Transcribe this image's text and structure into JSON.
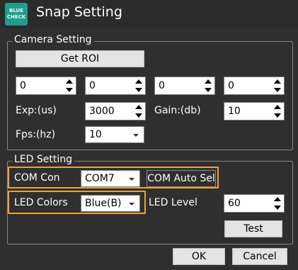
{
  "window": {
    "title": "Snap Setting",
    "logo_text_line1": "BLUE",
    "logo_text_line2": "CHECK"
  },
  "camera": {
    "group_title": "Camera Setting",
    "get_roi_label": "Get ROI",
    "roi_values": [
      "0",
      "0",
      "0",
      "0"
    ],
    "exp_label": "Exp:(us)",
    "exp_value": "3000",
    "gain_label": "Gain:(db)",
    "gain_value": "10",
    "fps_label": "Fps:(hz)",
    "fps_value": "10"
  },
  "led": {
    "group_title": "LED Setting",
    "com_label": "COM Con",
    "com_value": "COM7",
    "com_auto_label": "COM Auto Sel",
    "colors_label": "LED Colors",
    "colors_value": "Blue(B)",
    "level_label": "LED Level",
    "level_value": "60",
    "test_label": "Test"
  },
  "footer": {
    "ok_label": "OK",
    "cancel_label": "Cancel"
  },
  "colors": {
    "highlight": "#f0a23a",
    "logo": "#1f9e8a"
  }
}
